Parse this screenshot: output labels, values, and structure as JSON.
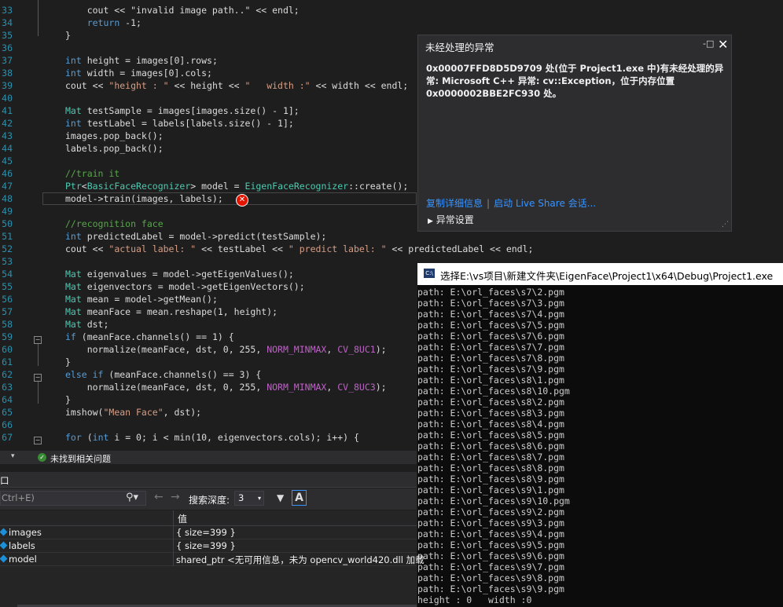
{
  "editor": {
    "lines": [
      {
        "n": "33",
        "html": "<span style='opacity:0'>x</span>"
      },
      {
        "n": "34",
        "html": "    <span class='kw'>return</span> -1;"
      },
      {
        "n": "35",
        "html": "}"
      },
      {
        "n": "36",
        "html": ""
      },
      {
        "n": "37",
        "html": "<span class='kw'>int</span> height = images[0].rows;"
      },
      {
        "n": "38",
        "html": "<span class='kw'>int</span> width = images[0].cols;"
      },
      {
        "n": "39",
        "html": "cout &lt;&lt; <span class='str'>\"height : \"</span> &lt;&lt; height &lt;&lt; <span class='str'>\"   width :\"</span> &lt;&lt; width &lt;&lt; endl;"
      },
      {
        "n": "40",
        "html": ""
      },
      {
        "n": "41",
        "html": "<span class='ty'>Mat</span> testSample = images[images.size() - 1];"
      },
      {
        "n": "42",
        "html": "<span class='kw'>int</span> testLabel = labels[labels.size() - 1];"
      },
      {
        "n": "43",
        "html": "images.pop_back();"
      },
      {
        "n": "44",
        "html": "labels.pop_back();"
      },
      {
        "n": "45",
        "html": ""
      },
      {
        "n": "46",
        "html": "<span class='cm'>//train it</span>"
      },
      {
        "n": "47",
        "html": "<span class='ty'>Ptr</span>&lt;<span class='ty'>BasicFaceRecognizer</span>&gt; model = <span class='ty'>EigenFaceRecognizer</span>::create();"
      },
      {
        "n": "48",
        "html": "model-&gt;train(images, labels);"
      },
      {
        "n": "49",
        "html": ""
      },
      {
        "n": "50",
        "html": "<span class='cm'>//recognition face</span>"
      },
      {
        "n": "51",
        "html": "<span class='kw'>int</span> predictedLabel = model-&gt;predict(testSample);"
      },
      {
        "n": "52",
        "html": "cout &lt;&lt; <span class='str'>\"actual label: \"</span> &lt;&lt; testLabel &lt;&lt; <span class='str'>\" predict label: \"</span> &lt;&lt; predictedLabel &lt;&lt; endl;"
      },
      {
        "n": "53",
        "html": ""
      },
      {
        "n": "54",
        "html": "<span class='ty'>Mat</span> eigenvalues = model-&gt;getEigenValues();"
      },
      {
        "n": "55",
        "html": "<span class='ty'>Mat</span> eigenvectors = model-&gt;getEigenVectors();"
      },
      {
        "n": "56",
        "html": "<span class='ty'>Mat</span> mean = model-&gt;getMean();"
      },
      {
        "n": "57",
        "html": "<span class='ty'>Mat</span> meanFace = mean.reshape(1, height);"
      },
      {
        "n": "58",
        "html": "<span class='ty'>Mat</span> dst;"
      },
      {
        "n": "59",
        "html": "<span class='kw'>if</span> (meanFace.channels() == 1) {"
      },
      {
        "n": "60",
        "html": "    normalize(meanFace, dst, 0, 255, <span class='mac'>NORM_MINMAX</span>, <span class='mac'>CV_8UC1</span>);"
      },
      {
        "n": "61",
        "html": "}"
      },
      {
        "n": "62",
        "html": "<span class='kw'>else if</span> (meanFace.channels() == 3) {"
      },
      {
        "n": "63",
        "html": "    normalize(meanFace, dst, 0, 255, <span class='mac'>NORM_MINMAX</span>, <span class='mac'>CV_8UC3</span>);"
      },
      {
        "n": "64",
        "html": "}"
      },
      {
        "n": "65",
        "html": "imshow(<span class='str'>\"Mean Face\"</span>, dst);"
      },
      {
        "n": "66",
        "html": ""
      },
      {
        "n": "67",
        "html": "<span class='kw'>for</span> (<span class='kw'>int</span> i = 0; i &lt; min(10, eigenvectors.cols); i++) {"
      }
    ],
    "line33_text": "    cout << \"invalid image path..\" << endl;"
  },
  "exception": {
    "title": "未经处理的异常",
    "message": "0x00007FFD8D5D9709 处(位于 Project1.exe 中)有未经处理的异常: Microsoft C++ 异常: cv::Exception，位于内存位置 0x0000002BBE2FC930 处。",
    "link_copy": "复制详细信息",
    "separator": "|",
    "link_liveshare": "启动 Live Share 会话...",
    "settings": "异常设置"
  },
  "console": {
    "title": "选择E:\\vs项目\\新建文件夹\\EigenFace\\Project1\\x64\\Debug\\Project1.exe",
    "lines": [
      "path: E:\\orl_faces\\s7\\2.pgm",
      "path: E:\\orl_faces\\s7\\3.pgm",
      "path: E:\\orl_faces\\s7\\4.pgm",
      "path: E:\\orl_faces\\s7\\5.pgm",
      "path: E:\\orl_faces\\s7\\6.pgm",
      "path: E:\\orl_faces\\s7\\7.pgm",
      "path: E:\\orl_faces\\s7\\8.pgm",
      "path: E:\\orl_faces\\s7\\9.pgm",
      "path: E:\\orl_faces\\s8\\1.pgm",
      "path: E:\\orl_faces\\s8\\10.pgm",
      "path: E:\\orl_faces\\s8\\2.pgm",
      "path: E:\\orl_faces\\s8\\3.pgm",
      "path: E:\\orl_faces\\s8\\4.pgm",
      "path: E:\\orl_faces\\s8\\5.pgm",
      "path: E:\\orl_faces\\s8\\6.pgm",
      "path: E:\\orl_faces\\s8\\7.pgm",
      "path: E:\\orl_faces\\s8\\8.pgm",
      "path: E:\\orl_faces\\s8\\9.pgm",
      "path: E:\\orl_faces\\s9\\1.pgm",
      "path: E:\\orl_faces\\s9\\10.pgm",
      "path: E:\\orl_faces\\s9\\2.pgm",
      "path: E:\\orl_faces\\s9\\3.pgm",
      "path: E:\\orl_faces\\s9\\4.pgm",
      "path: E:\\orl_faces\\s9\\5.pgm",
      "path: E:\\orl_faces\\s9\\6.pgm",
      "path: E:\\orl_faces\\s9\\7.pgm",
      "path: E:\\orl_faces\\s9\\8.pgm",
      "path: E:\\orl_faces\\s9\\9.pgm",
      "height : 0   width :0"
    ]
  },
  "status": {
    "text": "未找到相关问题"
  },
  "locals": {
    "title": "口",
    "search_placeholder": "Ctrl+E)",
    "depth_label": "搜索深度:",
    "depth_value": "3",
    "col_name": "",
    "col_value": "值",
    "rows": [
      {
        "name": "images",
        "value": "{ size=399 }"
      },
      {
        "name": "labels",
        "value": "{ size=399 }"
      },
      {
        "name": "model",
        "value": "shared_ptr <无可用信息，未为 opencv_world420.dll 加载"
      }
    ]
  },
  "colors": {
    "error": "#e51400",
    "link": "#3794ff",
    "success": "#388a34"
  }
}
